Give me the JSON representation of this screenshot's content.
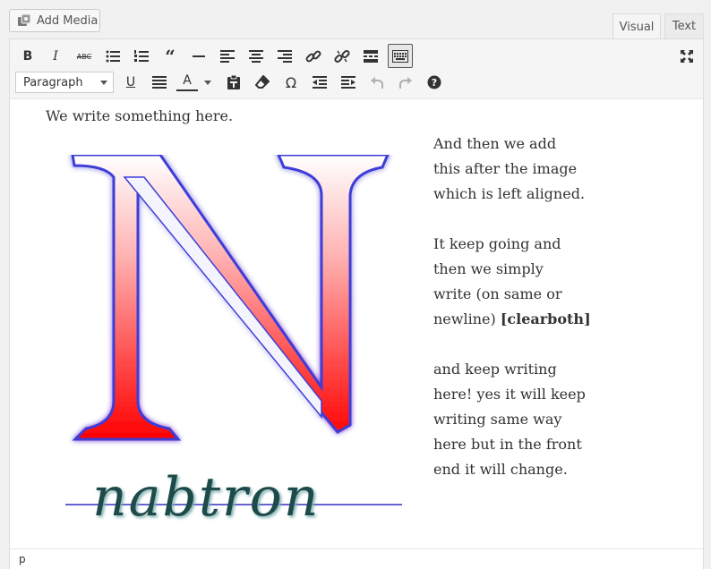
{
  "media": {
    "add_label": "Add Media"
  },
  "tabs": {
    "visual": "Visual",
    "text": "Text"
  },
  "toolbar": {
    "row1": [
      "bold",
      "italic",
      "strikethrough",
      "bulleted-list",
      "numbered-list",
      "blockquote",
      "horizontal-line",
      "align-left",
      "align-center",
      "align-right",
      "insert-link",
      "remove-link",
      "read-more",
      "toolbar-toggle"
    ],
    "row2": [
      "underline",
      "justify",
      "text-color",
      "paste-as-text",
      "clear-formatting",
      "special-character",
      "outdent",
      "indent",
      "undo",
      "redo",
      "help"
    ],
    "format_select": "Paragraph"
  },
  "content": {
    "intro": "We write something here.",
    "image_word": "nabtron",
    "lines1": [
      "And then we add",
      "this after the image",
      "which is left aligned."
    ],
    "lines2": [
      "It keep going and",
      "then we simply",
      "write (on same or"
    ],
    "line2_last_prefix": "newline) ",
    "line2_last_bold": "[clearboth]",
    "lines3": [
      "and keep writing",
      "here! yes it will keep",
      "writing same way",
      "here but in the front",
      "end it will change."
    ]
  },
  "status": {
    "path": "p"
  },
  "colors": {
    "letter_top": "#ffffff",
    "letter_bottom": "#ff0000",
    "word": "#1f4a4a",
    "rule": "#3030c0"
  }
}
